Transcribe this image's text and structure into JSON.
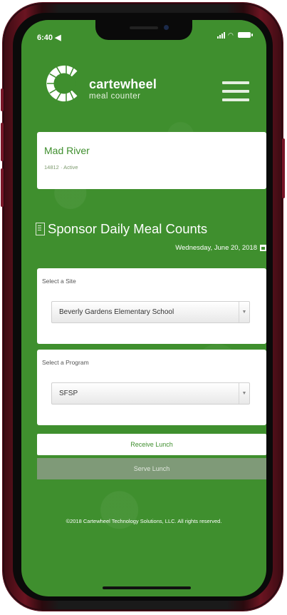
{
  "status_bar": {
    "time": "6:40 ◀"
  },
  "brand": {
    "name": "cartewheel",
    "subtitle": "meal counter"
  },
  "org": {
    "name": "Mad River",
    "status": "14812 · Active"
  },
  "page": {
    "title": "Sponsor Daily Meal Counts",
    "date": "Wednesday, June 20, 2018"
  },
  "site_select": {
    "label": "Select a Site",
    "value": "Beverly Gardens Elementary School"
  },
  "program_select": {
    "label": "Select a Program",
    "value": "SFSP"
  },
  "actions": {
    "primary_label": "Receive Lunch",
    "secondary_label": "Serve Lunch"
  },
  "footer": {
    "text": "©2018 Cartewheel Technology Solutions, LLC. All rights reserved."
  },
  "colors": {
    "brand_green": "#3f8f2e",
    "phone_frame": "#6b1421",
    "disabled_button": "#7f9a78"
  }
}
